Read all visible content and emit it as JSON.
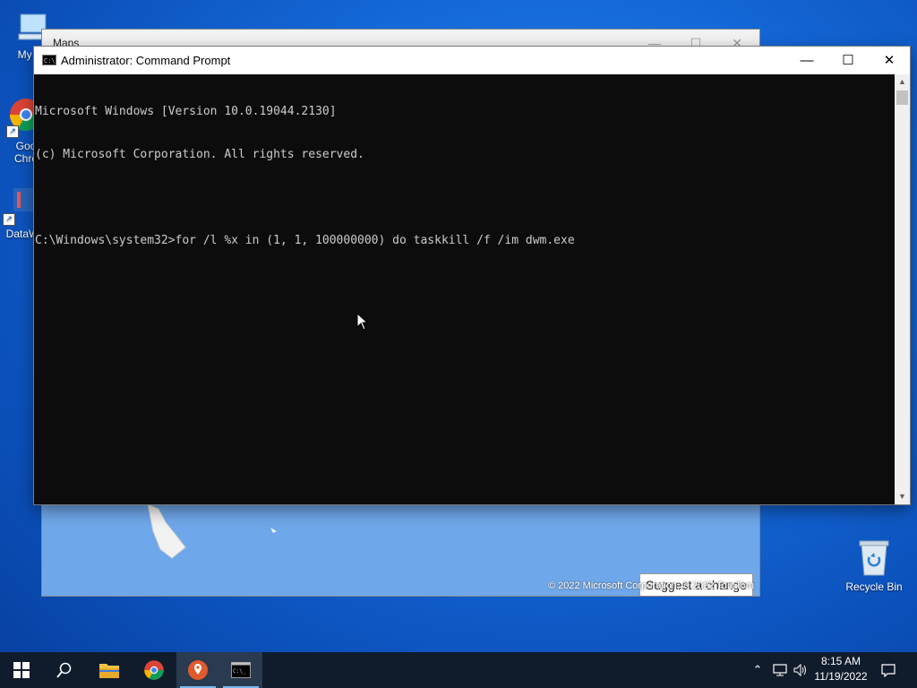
{
  "desktop": {
    "icons": [
      {
        "label": "My Co",
        "icon": "computer-icon"
      },
      {
        "label": "Goo\nChro",
        "icon": "chrome-icon"
      },
      {
        "label": "DataW",
        "icon": "datawrapper-icon"
      }
    ],
    "recycle_bin_label": "Recycle Bin"
  },
  "maps_window": {
    "title": "Maps",
    "suggest_label": "Suggest a change",
    "copyright": "© 2022 Microsoft Corporation, © 2022 TomTom"
  },
  "cmd_window": {
    "title": "Administrator: Command Prompt",
    "lines": [
      "Microsoft Windows [Version 10.0.19044.2130]",
      "(c) Microsoft Corporation. All rights reserved.",
      "",
      "C:\\Windows\\system32>for /l %x in (1, 1, 100000000) do taskkill /f /im dwm.exe"
    ],
    "minimize_glyph": "—",
    "maximize_glyph": "☐",
    "close_glyph": "✕"
  },
  "taskbar": {
    "items": [
      {
        "name": "start-button",
        "icon": "windows-icon"
      },
      {
        "name": "search-button",
        "icon": "search-icon"
      },
      {
        "name": "file-explorer-button",
        "icon": "folder-icon"
      },
      {
        "name": "chrome-button",
        "icon": "chrome-icon"
      },
      {
        "name": "maps-button",
        "icon": "maps-icon"
      },
      {
        "name": "cmd-button",
        "icon": "cmd-icon"
      }
    ],
    "clock_time": "8:15 AM",
    "clock_date": "11/19/2022"
  },
  "colors": {
    "console_bg": "#0c0c0c",
    "console_fg": "#cccccc",
    "taskbar_bg": "#101c2c",
    "accent": "#76b9ed"
  }
}
